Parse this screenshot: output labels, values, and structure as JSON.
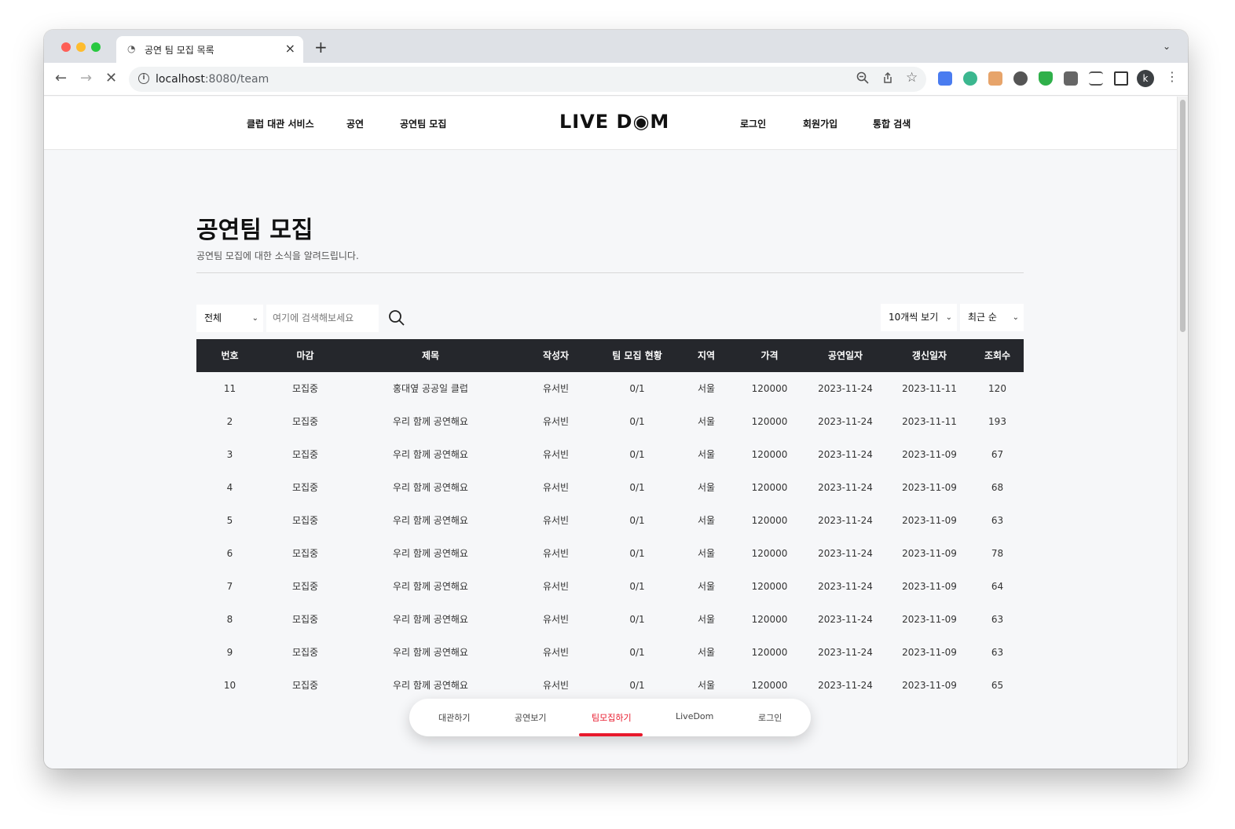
{
  "browser": {
    "tab_title": "공연 팀 모집 목록",
    "new_tab": "+",
    "url_host": "localhost",
    "url_rest": ":8080/team",
    "avatar_initial": "k"
  },
  "site": {
    "nav_left": [
      "클럽 대관 서비스",
      "공연",
      "공연팀 모집"
    ],
    "logo": "LIVE D◉M",
    "nav_right": [
      "로그인",
      "회원가입",
      "통합 검색"
    ]
  },
  "page": {
    "title": "공연팀 모집",
    "subtitle": "공연팀 모집에 대한 소식을 알려드립니다."
  },
  "filters": {
    "category_selected": "전체",
    "search_placeholder": "여기에 검색해보세요",
    "page_size_selected": "10개씩 보기",
    "sort_selected": "최근 순"
  },
  "table": {
    "headers": [
      "번호",
      "마감",
      "제목",
      "작성자",
      "팀 모집 현황",
      "지역",
      "가격",
      "공연일자",
      "갱신일자",
      "조회수"
    ],
    "rows": [
      [
        "11",
        "모집중",
        "홍대옆 공공일 클럽",
        "유서빈",
        "0/1",
        "서울",
        "120000",
        "2023-11-24",
        "2023-11-11",
        "120"
      ],
      [
        "2",
        "모집중",
        "우리 함께 공연해요",
        "유서빈",
        "0/1",
        "서울",
        "120000",
        "2023-11-24",
        "2023-11-11",
        "193"
      ],
      [
        "3",
        "모집중",
        "우리 함께 공연해요",
        "유서빈",
        "0/1",
        "서울",
        "120000",
        "2023-11-24",
        "2023-11-09",
        "67"
      ],
      [
        "4",
        "모집중",
        "우리 함께 공연해요",
        "유서빈",
        "0/1",
        "서울",
        "120000",
        "2023-11-24",
        "2023-11-09",
        "68"
      ],
      [
        "5",
        "모집중",
        "우리 함께 공연해요",
        "유서빈",
        "0/1",
        "서울",
        "120000",
        "2023-11-24",
        "2023-11-09",
        "63"
      ],
      [
        "6",
        "모집중",
        "우리 함께 공연해요",
        "유서빈",
        "0/1",
        "서울",
        "120000",
        "2023-11-24",
        "2023-11-09",
        "78"
      ],
      [
        "7",
        "모집중",
        "우리 함께 공연해요",
        "유서빈",
        "0/1",
        "서울",
        "120000",
        "2023-11-24",
        "2023-11-09",
        "64"
      ],
      [
        "8",
        "모집중",
        "우리 함께 공연해요",
        "유서빈",
        "0/1",
        "서울",
        "120000",
        "2023-11-24",
        "2023-11-09",
        "63"
      ],
      [
        "9",
        "모집중",
        "우리 함께 공연해요",
        "유서빈",
        "0/1",
        "서울",
        "120000",
        "2023-11-24",
        "2023-11-09",
        "63"
      ],
      [
        "10",
        "모집중",
        "우리 함께 공연해요",
        "유서빈",
        "0/1",
        "서울",
        "120000",
        "2023-11-24",
        "2023-11-09",
        "65"
      ]
    ]
  },
  "bottom_nav": {
    "items": [
      "대관하기",
      "공연보기",
      "팀모집하기",
      "LiveDom",
      "로그인"
    ],
    "active_index": 2
  },
  "colors": {
    "accent": "#e8192c",
    "table_header_bg": "#25272c",
    "page_bg": "#f6f7f9"
  }
}
